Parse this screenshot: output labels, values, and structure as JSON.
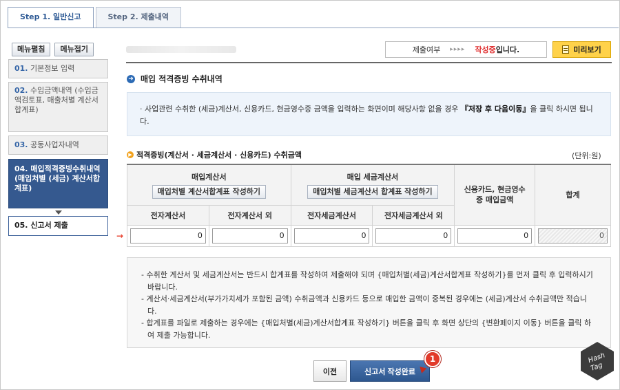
{
  "tabs": [
    {
      "label": "Step 1. 일반신고",
      "active": true
    },
    {
      "label": "Step 2. 제출내역",
      "active": false
    }
  ],
  "menu": {
    "expand_label": "메뉴펼침",
    "collapse_label": "메뉴접기",
    "steps": [
      {
        "num": "01.",
        "label": "기본정보 입력"
      },
      {
        "num": "02.",
        "label": "수입금액내역 (수입금액검토표, 매출처별 계산서 합계표)"
      },
      {
        "num": "03.",
        "label": "공동사업자내역"
      },
      {
        "num": "04.",
        "label": "매입적격증빙수취내역 (매입처별 (세금) 계산서합계표)"
      },
      {
        "num": "05.",
        "label": "신고서 제출"
      }
    ]
  },
  "status": {
    "label": "제출여부",
    "arrows": "▸▸▸▸",
    "state": "작성중",
    "state_suffix": "입니다."
  },
  "preview_label": "미리보기",
  "section_title": "매입 적격증빙 수취내역",
  "info": {
    "text_before": "· 사업관련 수취한 (세금)계산서, 신용카드, 현금영수증 금액을 입력하는 화면이며 해당사항 없을 경우 ",
    "emphasis": "『저장 후 다음이동』",
    "text_after": "을 클릭 하시면 됩니다."
  },
  "subsection_title": "적격증빙(계산서 · 세금계산서 · 신용카드) 수취금액",
  "unit_label": "(단위:원)",
  "table": {
    "group1": {
      "label": "매입계산서",
      "button": "매입처별 계산서합계표 작성하기"
    },
    "group2": {
      "label": "매입 세금계산서",
      "button": "매입처별 세금계산서 합계표 작성하기"
    },
    "card_header": "신용카드, 현금영수증 매입금액",
    "total_header": "합계",
    "sub_headers": [
      "전자계산서",
      "전자계산서 외",
      "전자세금계산서",
      "전자세금계산서 외"
    ],
    "values": [
      "0",
      "0",
      "0",
      "0",
      "0",
      "0"
    ]
  },
  "notes": [
    "- 수취한 계산서 및 세금계산서는 반드시 합계표를 작성하여 제출해야 되며 {매입처별(세금)계산서합계표 작성하기}를 먼저 클릭 후 입력하시기 바랍니다.",
    "- 계산서·세금계산서(부가가치세가 포함된 금액) 수취금액과 신용카드 등으로 매입한 금액이 중복된 경우에는 (세금)계산서 수취금액만 적습니다.",
    "- 합계표를 파일로 제출하는 경우에는 {매입처별(세금)계산서합계표 작성하기} 버튼을 클릭 후 화면 상단의 {변환페이지 이동} 버튼을 클릭 하여 제출 가능합니다."
  ],
  "buttons": {
    "prev": "이전",
    "done": "신고서 작성완료"
  },
  "badge": "1",
  "watermark": {
    "line1": "Hash",
    "line2": "Tag"
  }
}
